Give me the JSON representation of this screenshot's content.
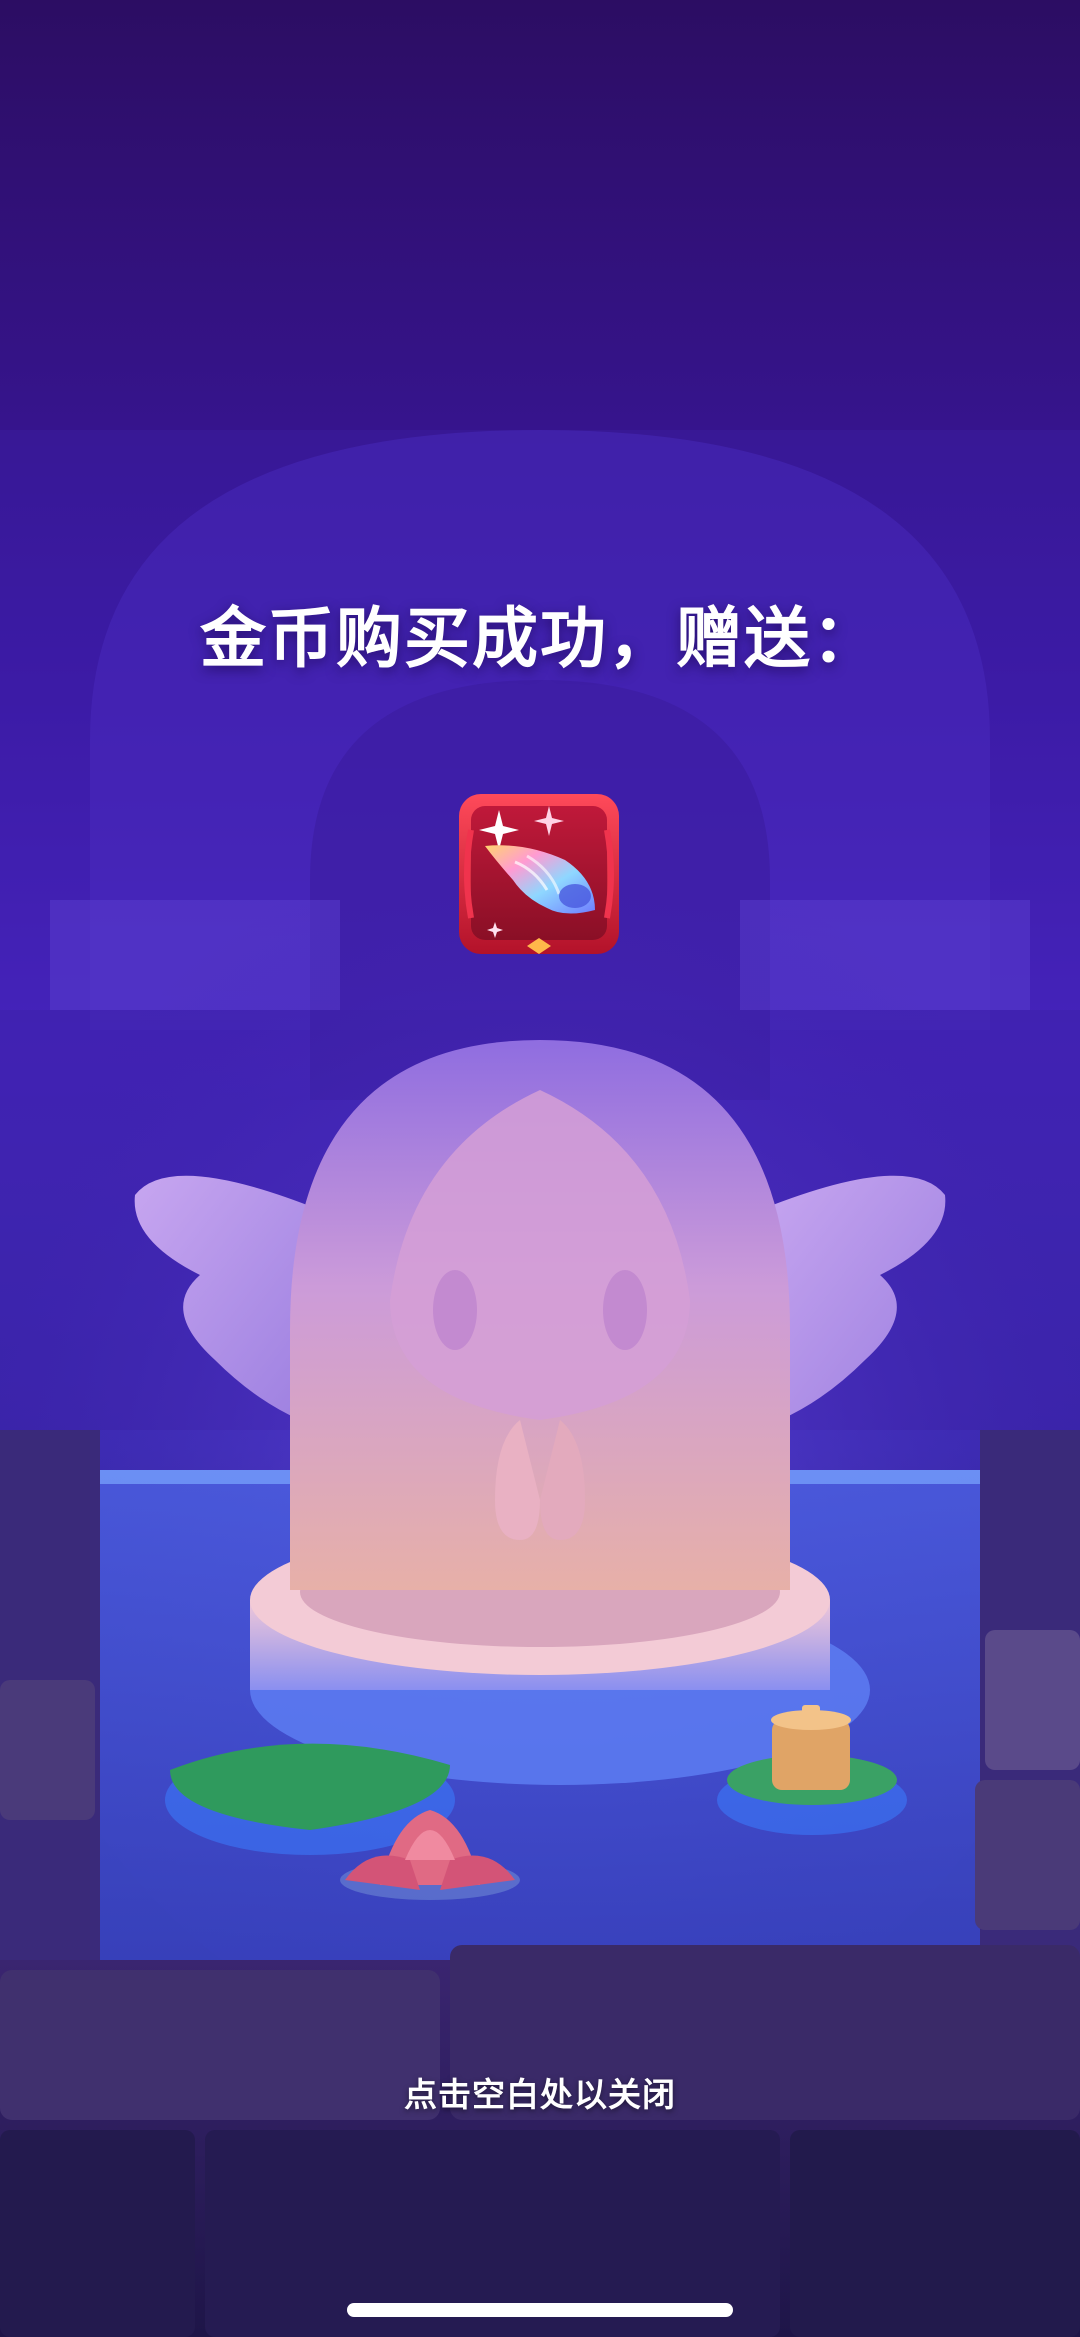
{
  "dialog": {
    "title": "金币购买成功，赠送：",
    "reward_item": {
      "icon": "rainbow-conch-shell-icon",
      "frame_color": "#d6243a"
    },
    "close_hint": "点击空白处以关闭"
  },
  "colors": {
    "background_top": "#2c0d63",
    "background_mid": "#4a26c7",
    "background_bottom": "#1b1447",
    "statue": "#d9a3d6",
    "water_glow": "#4f8cff",
    "lily_pad": "#2f9a5d",
    "lotus": "#e06a84"
  }
}
